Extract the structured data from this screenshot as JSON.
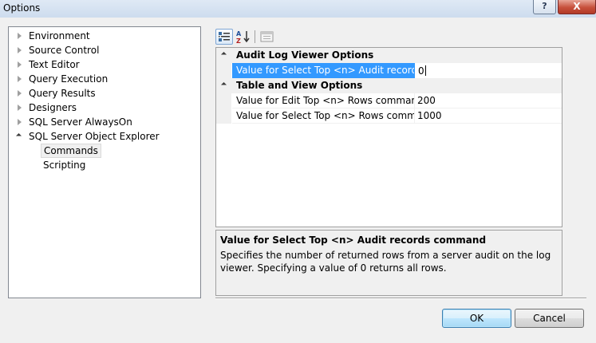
{
  "window": {
    "title": "Options",
    "help_label": "?",
    "close_label": "X"
  },
  "tree": {
    "items": [
      {
        "label": "Environment",
        "expanded": false
      },
      {
        "label": "Source Control",
        "expanded": false
      },
      {
        "label": "Text Editor",
        "expanded": false
      },
      {
        "label": "Query Execution",
        "expanded": false
      },
      {
        "label": "Query Results",
        "expanded": false
      },
      {
        "label": "Designers",
        "expanded": false
      },
      {
        "label": "SQL Server AlwaysOn",
        "expanded": false
      },
      {
        "label": "SQL Server Object Explorer",
        "expanded": true
      }
    ],
    "children": [
      {
        "label": "Commands",
        "selected": true
      },
      {
        "label": "Scripting",
        "selected": false
      }
    ]
  },
  "toolbar": {
    "categorized_icon": "categorized-icon",
    "alphabetical_icon": "alphabetical-sort-icon",
    "property_pages_icon": "property-pages-icon"
  },
  "grid": {
    "categories": [
      {
        "label": "Audit Log Viewer Options",
        "properties": [
          {
            "name": "Value for Select Top <n> Audit records command",
            "value": "0",
            "selected": true
          }
        ]
      },
      {
        "label": "Table and View Options",
        "properties": [
          {
            "name": "Value for Edit Top <n> Rows command",
            "value": "200",
            "selected": false
          },
          {
            "name": "Value for Select Top <n> Rows command",
            "value": "1000",
            "selected": false
          }
        ]
      }
    ]
  },
  "description": {
    "title": "Value for Select Top <n> Audit records command",
    "text": "Specifies the number of returned rows from a server audit on the log viewer. Specifying a value of 0 returns all rows."
  },
  "buttons": {
    "ok": "OK",
    "cancel": "Cancel"
  },
  "colors": {
    "selection": "#3399ff",
    "category_bg": "#f0f0f0",
    "dialog_bg": "#f0f0f0"
  }
}
